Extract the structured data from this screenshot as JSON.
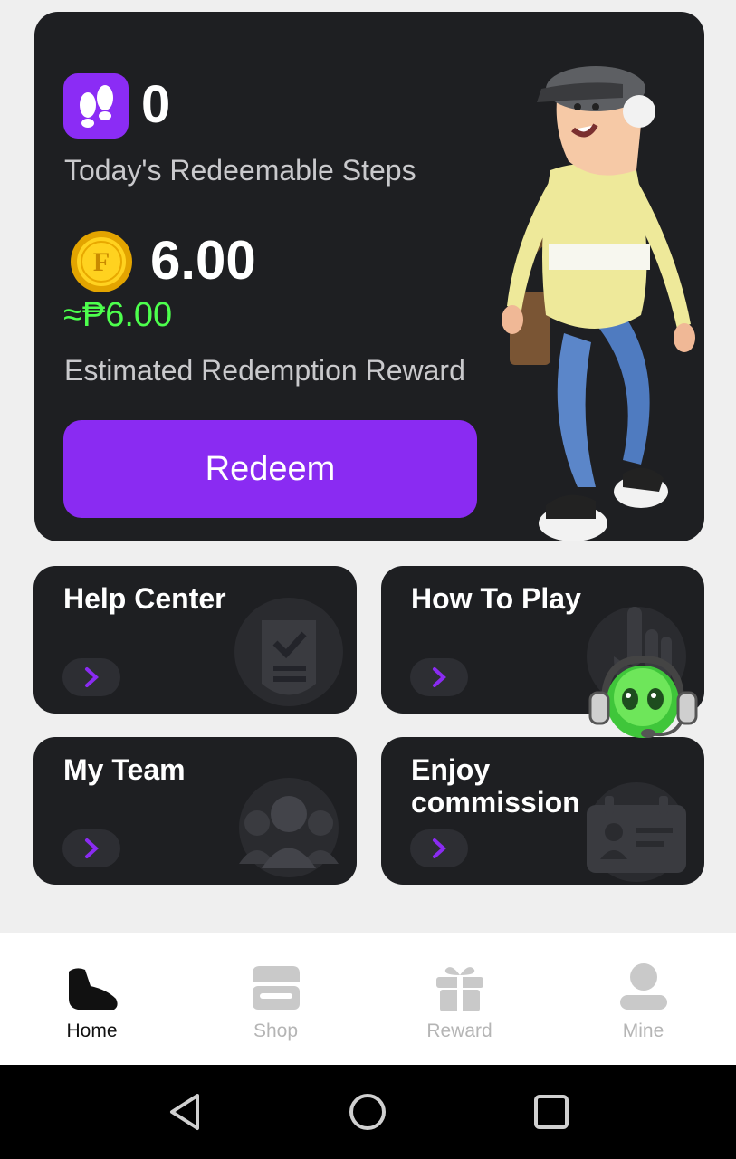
{
  "hero": {
    "steps_value": "0",
    "steps_label": "Today's Redeemable Steps",
    "coin_value": "6.00",
    "peso_value": "≈₱6.00",
    "reward_label": "Estimated Redemption Reward",
    "redeem_label": "Redeem"
  },
  "cards": [
    {
      "title": "Help Center",
      "icon": "shield-check-icon"
    },
    {
      "title": "How To Play",
      "icon": "hand-tap-icon"
    },
    {
      "title": "My Team",
      "icon": "team-icon"
    },
    {
      "title": "Enjoy commission",
      "icon": "id-card-icon"
    }
  ],
  "tabbar": {
    "items": [
      {
        "label": "Home",
        "icon": "shoe-icon",
        "active": true
      },
      {
        "label": "Shop",
        "icon": "shop-icon",
        "active": false
      },
      {
        "label": "Reward",
        "icon": "gift-icon",
        "active": false
      },
      {
        "label": "Mine",
        "icon": "user-icon",
        "active": false
      }
    ]
  },
  "colors": {
    "accent": "#8a2bf2",
    "peso_green": "#4dff4d",
    "card_bg": "#1e1f22"
  }
}
